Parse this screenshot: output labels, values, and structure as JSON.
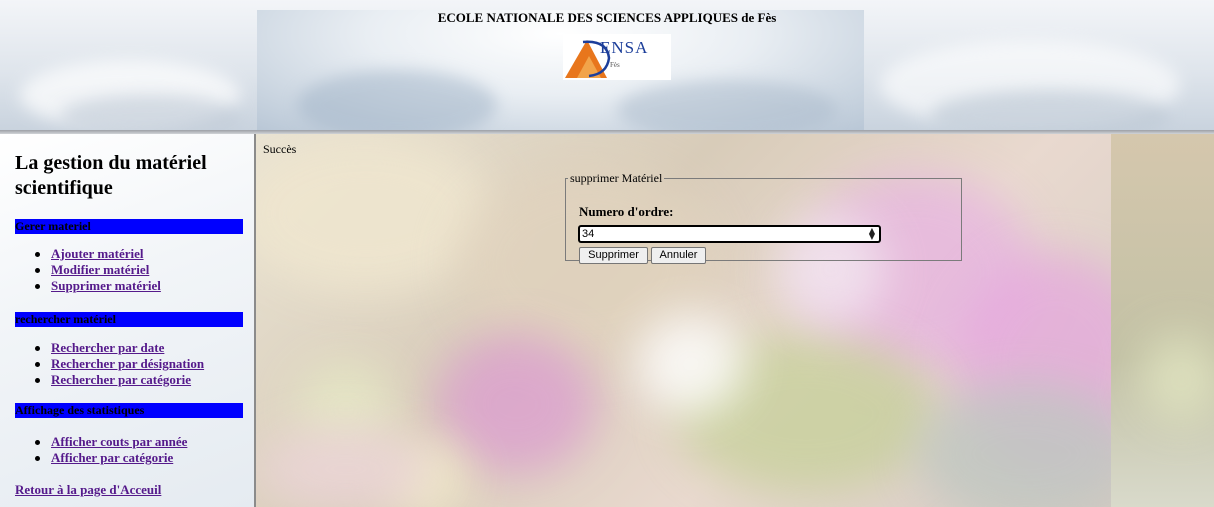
{
  "header": {
    "title": "ECOLE NATIONALE DES SCIENCES APPLIQUES de Fès",
    "logo_text": "ENSA",
    "logo_sub": "Fès"
  },
  "sidebar": {
    "title": "La gestion du matériel scientifique",
    "sections": [
      {
        "label": "Gerer materiel",
        "links": [
          "Ajouter matériel",
          "Modifier matériel",
          "Supprimer matériel"
        ]
      },
      {
        "label": "rechercher matériel",
        "links": [
          "Rechercher par date",
          "Rechercher par désignation",
          "Rechercher par catégorie"
        ]
      },
      {
        "label": "Affichage des statistiques",
        "links": [
          "Afficher couts par année",
          "Afficher par catégorie"
        ]
      }
    ],
    "home_link": "Retour à la page d'Acceuil"
  },
  "main": {
    "status": "Succès",
    "form": {
      "legend": "supprimer Matériel",
      "label": "Numero d'ordre:",
      "value": "34",
      "delete_button": "Supprimer",
      "cancel_button": "Annuler"
    }
  },
  "colors": {
    "section_bar": "#0000ff",
    "link": "#551a8b"
  }
}
